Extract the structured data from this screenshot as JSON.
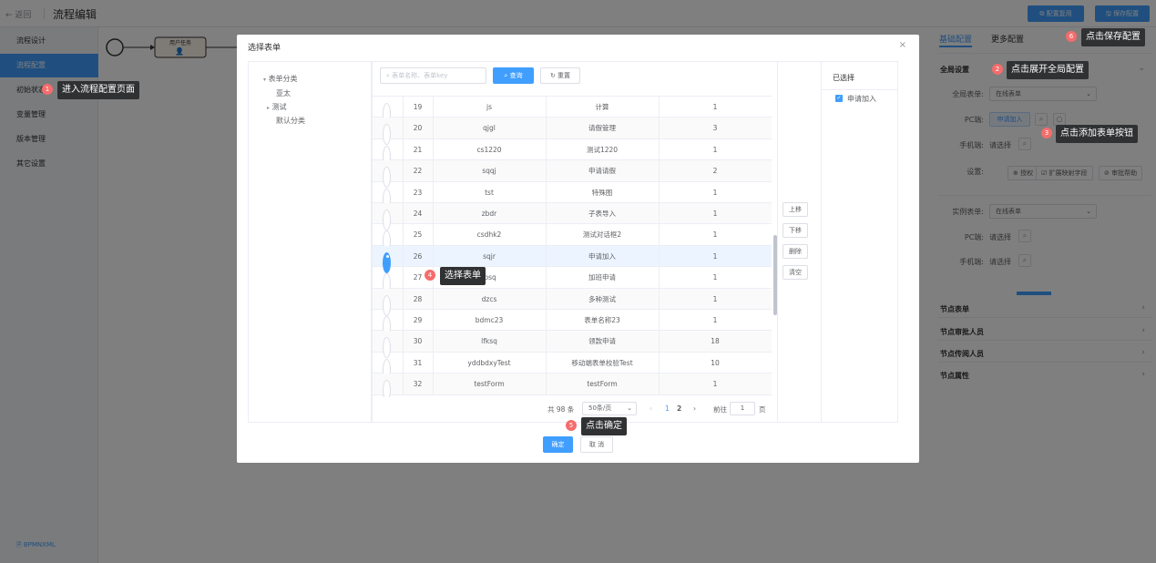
{
  "header": {
    "back": "← 返回",
    "title": "流程编辑",
    "btn_reuse": "配置复用",
    "btn_save": "保存配置"
  },
  "sidebar": {
    "items": [
      "流程设计",
      "流程配置",
      "初始状态",
      "变量管理",
      "版本管理",
      "其它设置"
    ],
    "footer": "BPMNXML"
  },
  "canvas": {
    "task_label": "用户任务"
  },
  "right": {
    "tab_basic": "基础配置",
    "tab_more": "更多配置",
    "global_title": "全局设置",
    "global_form_label": "全局表单:",
    "global_form_value": "在线表单",
    "pc_label": "PC端:",
    "pc_value": "申请加入",
    "mobile_label": "手机端:",
    "mobile_value": "请选择",
    "settings_label": "设置:",
    "btn_auth": "授权",
    "btn_extend": "扩展映射字段",
    "btn_help": "审批帮助",
    "instance_label": "实例表单:",
    "instance_value": "在线表单",
    "pc2_value": "请选择",
    "mobile2_value": "请选择",
    "sections": [
      "节点表单",
      "节点审批人员",
      "节点传阅人员",
      "节点属性"
    ]
  },
  "dialog": {
    "title": "选择表单",
    "close": "×",
    "tree": [
      "表单分类",
      "亚太",
      "测试",
      "默认分类"
    ],
    "search_placeholder": "表单名称、表单key",
    "query": "查询",
    "reset": "重置",
    "rows": [
      {
        "no": "19",
        "key": "js",
        "name": "计算",
        "count": "1"
      },
      {
        "no": "20",
        "key": "qjgl",
        "name": "请假管理",
        "count": "3"
      },
      {
        "no": "21",
        "key": "cs1220",
        "name": "测试1220",
        "count": "1"
      },
      {
        "no": "22",
        "key": "sqqj",
        "name": "申请请假",
        "count": "2"
      },
      {
        "no": "23",
        "key": "tst",
        "name": "特殊图",
        "count": "1"
      },
      {
        "no": "24",
        "key": "zbdr",
        "name": "子表导入",
        "count": "1"
      },
      {
        "no": "25",
        "key": "csdhk2",
        "name": "测试对话框2",
        "count": "1"
      },
      {
        "no": "26",
        "key": "sqjr",
        "name": "申请加入",
        "count": "1"
      },
      {
        "no": "27",
        "key": "jbsq",
        "name": "加班申请",
        "count": "1"
      },
      {
        "no": "28",
        "key": "dzcs",
        "name": "多种测试",
        "count": "1"
      },
      {
        "no": "29",
        "key": "bdmc23",
        "name": "表单名称23",
        "count": "1"
      },
      {
        "no": "30",
        "key": "lfksq",
        "name": "领款申请",
        "count": "18"
      },
      {
        "no": "31",
        "key": "yddbdxyTest",
        "name": "移动端表单校验Test",
        "count": "10"
      },
      {
        "no": "32",
        "key": "testForm",
        "name": "testForm",
        "count": "1"
      }
    ],
    "selected_no": "26",
    "pager": {
      "total": "共 98 条",
      "size": "50条/页",
      "page1": "1",
      "page2": "2",
      "goto": "前往",
      "goto_val": "1",
      "page_unit": "页"
    },
    "move": [
      "上移",
      "下移",
      "删除",
      "清空"
    ],
    "selected_title": "已选择",
    "selected_item": "申请加入",
    "ok": "确定",
    "cancel": "取 消"
  },
  "tips": [
    {
      "n": "1",
      "text": "进入流程配置页面"
    },
    {
      "n": "2",
      "text": "点击展开全局配置"
    },
    {
      "n": "3",
      "text": "点击添加表单按钮"
    },
    {
      "n": "4",
      "text": "选择表单"
    },
    {
      "n": "5",
      "text": "点击确定"
    },
    {
      "n": "6",
      "text": "点击保存配置"
    }
  ]
}
